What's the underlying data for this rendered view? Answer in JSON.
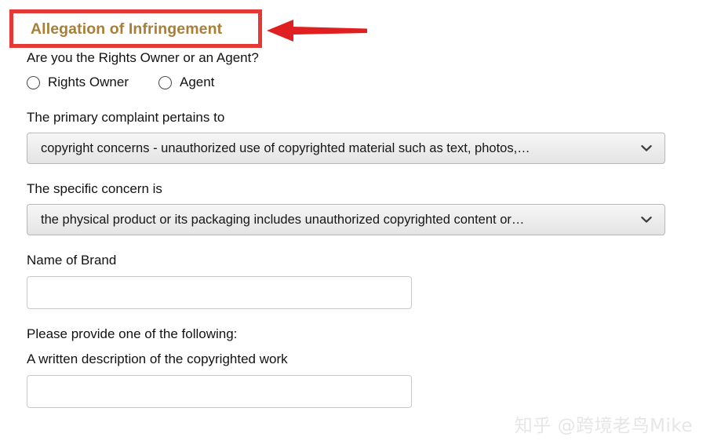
{
  "annotation": {
    "highlight_color": "#e53935",
    "arrow_color": "#e02020",
    "arrow_icon": "left-arrow-icon"
  },
  "header": {
    "title": "Allegation of Infringement",
    "title_color": "#a77f36"
  },
  "form": {
    "owner_question": {
      "label": "Are you the Rights Owner or an Agent?",
      "options": [
        {
          "label": "Rights Owner",
          "selected": false
        },
        {
          "label": "Agent",
          "selected": false
        }
      ]
    },
    "primary_complaint": {
      "label": "The primary complaint pertains to",
      "value": "copyright concerns - unauthorized use of copyrighted material such as text, photos,…",
      "chevron_icon": "chevron-down-icon"
    },
    "specific_concern": {
      "label": "The specific concern is",
      "value": "the physical product or its packaging includes unauthorized copyrighted content or…",
      "chevron_icon": "chevron-down-icon"
    },
    "brand_name": {
      "label": "Name of Brand",
      "value": "",
      "placeholder": ""
    },
    "provide_one": {
      "label": "Please provide one of the following:"
    },
    "written_description": {
      "label": "A written description of the copyrighted work",
      "value": "",
      "placeholder": ""
    }
  },
  "watermark": {
    "text": "知乎 @跨境老鸟Mike"
  }
}
